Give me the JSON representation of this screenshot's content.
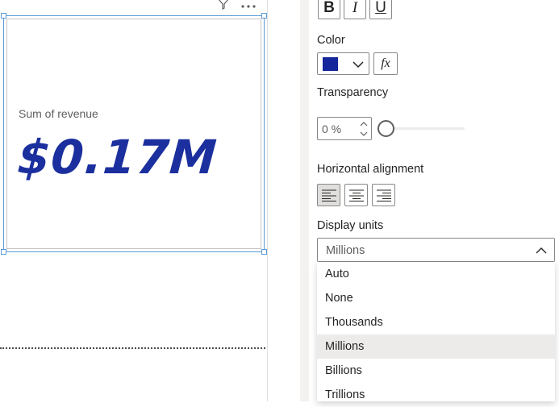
{
  "card": {
    "label": "Sum of revenue",
    "value": "$0.17M"
  },
  "format": {
    "bold_label": "B",
    "italic_label": "I",
    "underline_label": "U",
    "color_label": "Color",
    "color_value": "#15279a",
    "fx_label": "fx",
    "transparency_label": "Transparency",
    "transparency_value": "0 %",
    "alignment_label": "Horizontal alignment",
    "display_units_label": "Display units",
    "display_units_value": "Millions",
    "display_units_options": [
      "Auto",
      "None",
      "Thousands",
      "Millions",
      "Billions",
      "Trillions"
    ]
  },
  "colors": {
    "accent_value": "#1b2f9e",
    "selection_border": "#5b9bd5"
  }
}
